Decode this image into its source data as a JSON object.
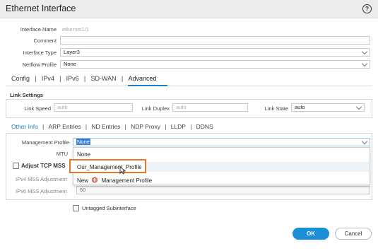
{
  "window": {
    "title": "Ethernet Interface",
    "help_glyph": "?"
  },
  "general": {
    "interface_name_label": "Interface Name",
    "interface_name_value": "ethernet1/1",
    "comment_label": "Comment",
    "comment_value": "",
    "interface_type_label": "Interface Type",
    "interface_type_value": "Layer3",
    "netflow_label": "Netflow Profile",
    "netflow_value": "None"
  },
  "tabs": [
    {
      "label": "Config"
    },
    {
      "label": "IPv4"
    },
    {
      "label": "IPv6"
    },
    {
      "label": "SD-WAN"
    },
    {
      "label": "Advanced",
      "active": true
    }
  ],
  "link_settings": {
    "title": "Link Settings",
    "speed_label": "Link Speed",
    "speed_placeholder": "auto",
    "duplex_label": "Link Duplex",
    "duplex_placeholder": "auto",
    "state_label": "Link State",
    "state_value": "auto"
  },
  "subtabs": [
    {
      "label": "Other Info",
      "active": true
    },
    {
      "label": "ARP Entries"
    },
    {
      "label": "ND Entries"
    },
    {
      "label": "NDP Proxy"
    },
    {
      "label": "LLDP"
    },
    {
      "label": "DDNS"
    }
  ],
  "other_info": {
    "mgmt_profile_label": "Management Profile",
    "mgmt_profile_value": "None",
    "mtu_label": "MTU",
    "adjust_tcp_mss_label": "Adjust TCP MSS",
    "ipv4_mss_label": "IPv4 MSS Adjustment",
    "ipv6_mss_label": "IPv6 MSS Adjustment",
    "ipv6_mss_value": "60",
    "untagged_label": "Untagged Subinterface"
  },
  "dropdown": {
    "items": [
      "None",
      "Our_Management_Profile"
    ],
    "new_prefix": "New",
    "new_label": "Management Profile"
  },
  "buttons": {
    "ok": "OK",
    "cancel": "Cancel"
  },
  "colors": {
    "accent": "#1a7fbf",
    "ok_button": "#1a8fd8",
    "highlight_border": "#e8762d"
  }
}
